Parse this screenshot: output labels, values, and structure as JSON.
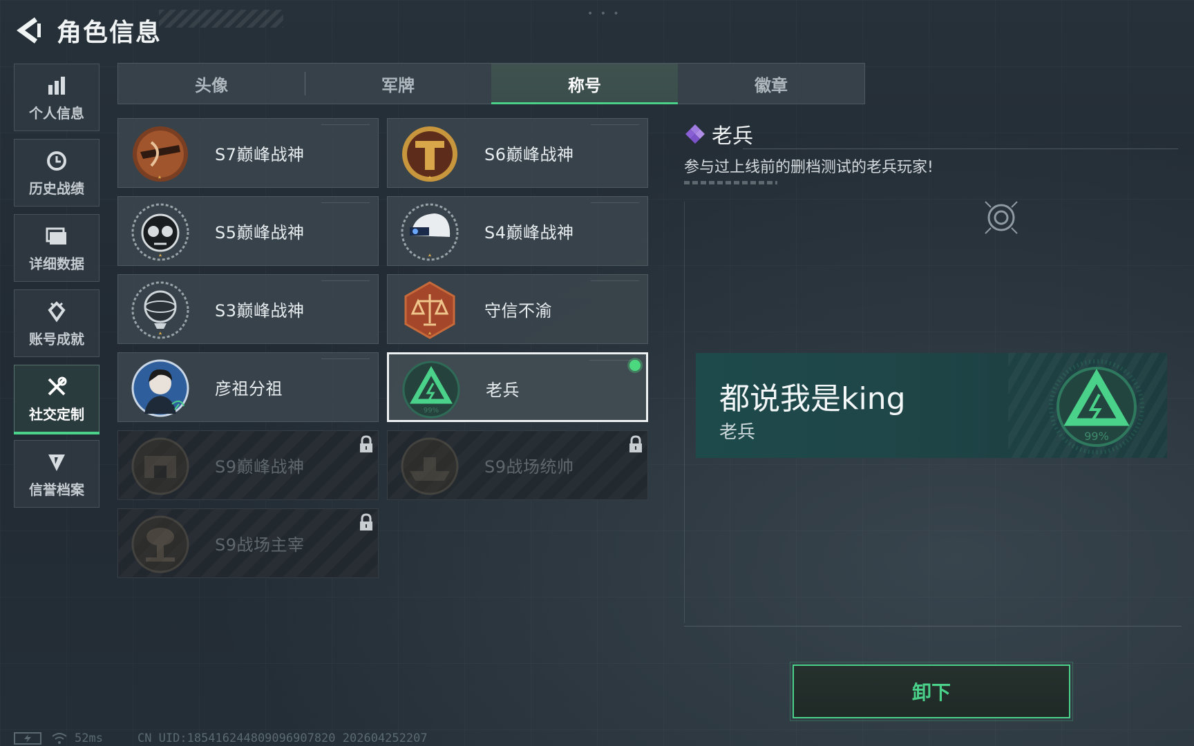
{
  "header": {
    "title": "角色信息",
    "back_icon": "back-arrow-icon"
  },
  "sidebar": {
    "items": [
      {
        "label": "个人信息",
        "icon": "bar-chart-icon"
      },
      {
        "label": "历史战绩",
        "icon": "clock-icon"
      },
      {
        "label": "详细数据",
        "icon": "folder-icon"
      },
      {
        "label": "账号成就",
        "icon": "achievement-icon"
      },
      {
        "label": "社交定制",
        "icon": "tools-icon",
        "active": true
      },
      {
        "label": "信誉档案",
        "icon": "shield-icon"
      }
    ]
  },
  "tabs": [
    {
      "label": "头像"
    },
    {
      "label": "军牌"
    },
    {
      "label": "称号",
      "active": true
    },
    {
      "label": "徽章"
    }
  ],
  "titles": [
    {
      "label": "S7巅峰战神",
      "icon": "crossbow-emblem-icon",
      "locked": false
    },
    {
      "label": "S6巅峰战神",
      "icon": "gold-t-emblem-icon",
      "locked": false
    },
    {
      "label": "S5巅峰战神",
      "icon": "skull-mask-emblem-icon",
      "locked": false
    },
    {
      "label": "S4巅峰战神",
      "icon": "helmet-emblem-icon",
      "locked": false
    },
    {
      "label": "S3巅峰战神",
      "icon": "globe-emblem-icon",
      "locked": false
    },
    {
      "label": "守信不渝",
      "icon": "scales-emblem-icon",
      "locked": false
    },
    {
      "label": "彦祖分祖",
      "icon": "portrait-emblem-icon",
      "locked": false
    },
    {
      "label": "老兵",
      "icon": "veteran-triangle-icon",
      "locked": false,
      "selected": true,
      "equipped": true,
      "emblem_text": "99%"
    },
    {
      "label": "S9巅峰战神",
      "icon": "fortress-emblem-icon",
      "locked": true
    },
    {
      "label": "S9战场统帅",
      "icon": "ship-emblem-icon",
      "locked": true
    },
    {
      "label": "S9战场主宰",
      "icon": "mushroom-cloud-emblem-icon",
      "locked": true
    }
  ],
  "detail": {
    "name": "老兵",
    "description": "参与过上线前的删档测试的老兵玩家!",
    "rarity_icon": "purple-diamond-icon"
  },
  "nameplate": {
    "player_name": "都说我是king",
    "title": "老兵",
    "emblem_text": "99%"
  },
  "actions": {
    "unequip_label": "卸下"
  },
  "status": {
    "ping": "52ms",
    "uid": "CN UID:185416244809096907820 202604252207"
  },
  "colors": {
    "accent": "#4bd28a",
    "background": "#242e36",
    "card": "#3a444c",
    "rarity": "#9b6bdc"
  }
}
